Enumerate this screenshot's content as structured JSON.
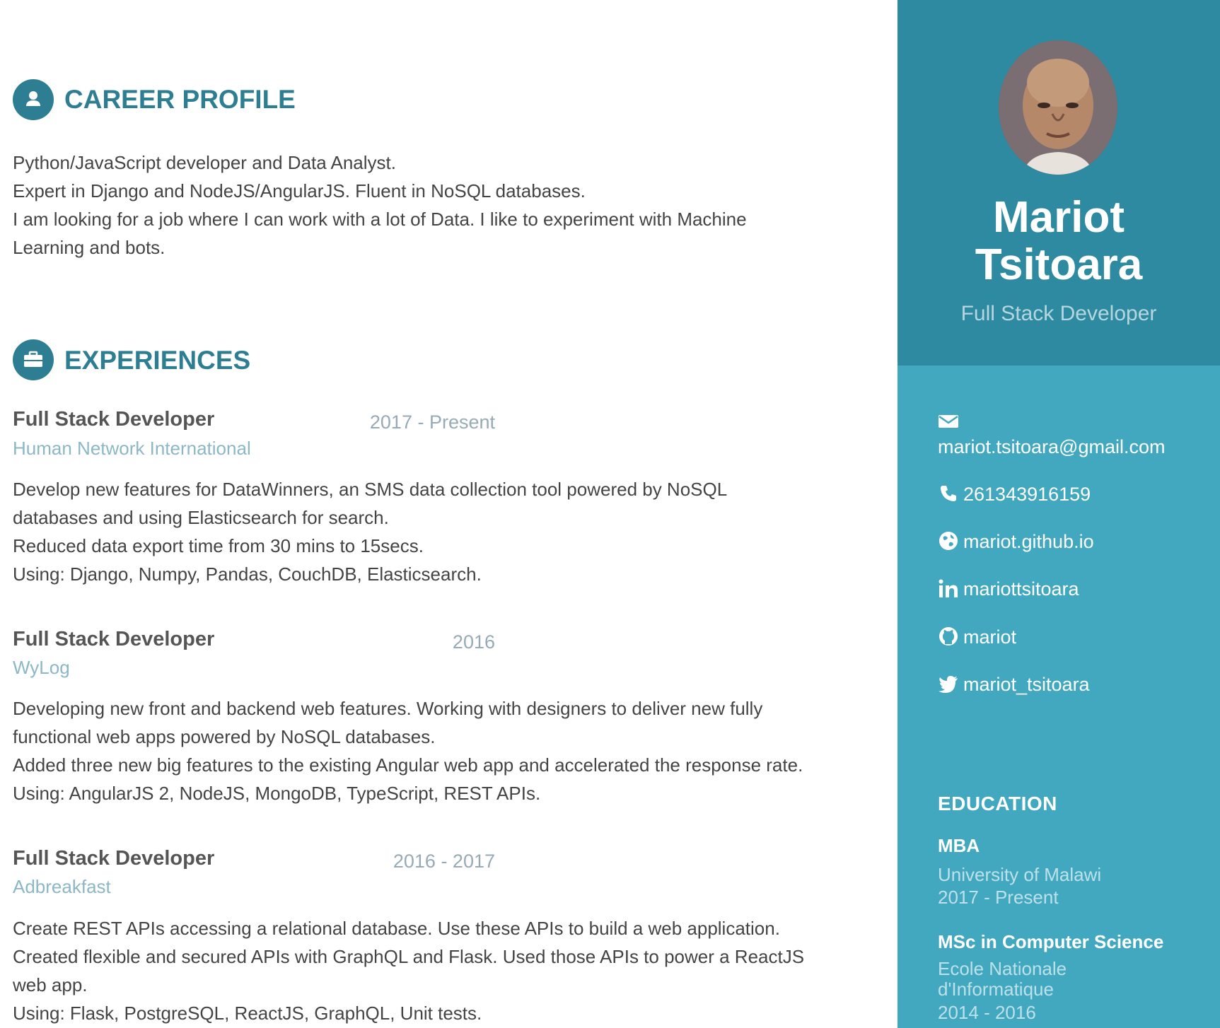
{
  "sidebar": {
    "name_line1": "Mariot",
    "name_line2": "Tsitoara",
    "tagline": "Full Stack Developer",
    "contacts": {
      "email": "mariot.tsitoara@gmail.com",
      "phone": "261343916159",
      "website": "mariot.github.io",
      "linkedin": "mariottsitoara",
      "github": "mariot",
      "twitter": "mariot_tsitoara"
    },
    "education": {
      "title": "EDUCATION",
      "items": [
        {
          "degree": "MBA",
          "school": "University of Malawi",
          "time": "2017 - Present"
        },
        {
          "degree": "MSc in Computer Science",
          "school_line1": "Ecole Nationale",
          "school_line2": "d'Informatique",
          "time": "2014 - 2016"
        }
      ]
    }
  },
  "main": {
    "career_profile": {
      "title": "CAREER PROFILE",
      "lines": [
        "Python/JavaScript developer and Data Analyst.",
        "Expert in Django and NodeJS/AngularJS. Fluent in NoSQL databases.",
        "I am looking for a job where I can work with a lot of Data. I like to experiment with Machine",
        "Learning and bots."
      ]
    },
    "experiences": {
      "title": "EXPERIENCES",
      "items": [
        {
          "title": "Full Stack Developer",
          "time": "2017 - Present",
          "company": "Human Network International",
          "lines": [
            "Develop new features for DataWinners, an SMS data collection tool powered by NoSQL",
            "databases and using Elasticsearch for search.",
            "Reduced data export time from 30 mins to 15secs.",
            "Using: Django, Numpy, Pandas, CouchDB, Elasticsearch."
          ]
        },
        {
          "title": "Full Stack Developer",
          "time": "2016",
          "company": "WyLog",
          "lines": [
            "Developing new front and backend web features. Working with designers to deliver new fully",
            "functional web apps powered by NoSQL databases.",
            "Added three new big features to the existing Angular web app and accelerated the response rate.",
            "Using: AngularJS 2, NodeJS, MongoDB, TypeScript, REST APIs."
          ]
        },
        {
          "title": "Full Stack Developer",
          "time": "2016 - 2017",
          "company": "Adbreakfast",
          "lines": [
            "Create REST APIs accessing a relational database. Use these APIs to build a web application.",
            "Created flexible and secured APIs with GraphQL and Flask. Used those APIs to power a ReactJS",
            "web app.",
            "Using: Flask, PostgreSQL, ReactJS, GraphQL, Unit tests."
          ]
        }
      ]
    }
  }
}
